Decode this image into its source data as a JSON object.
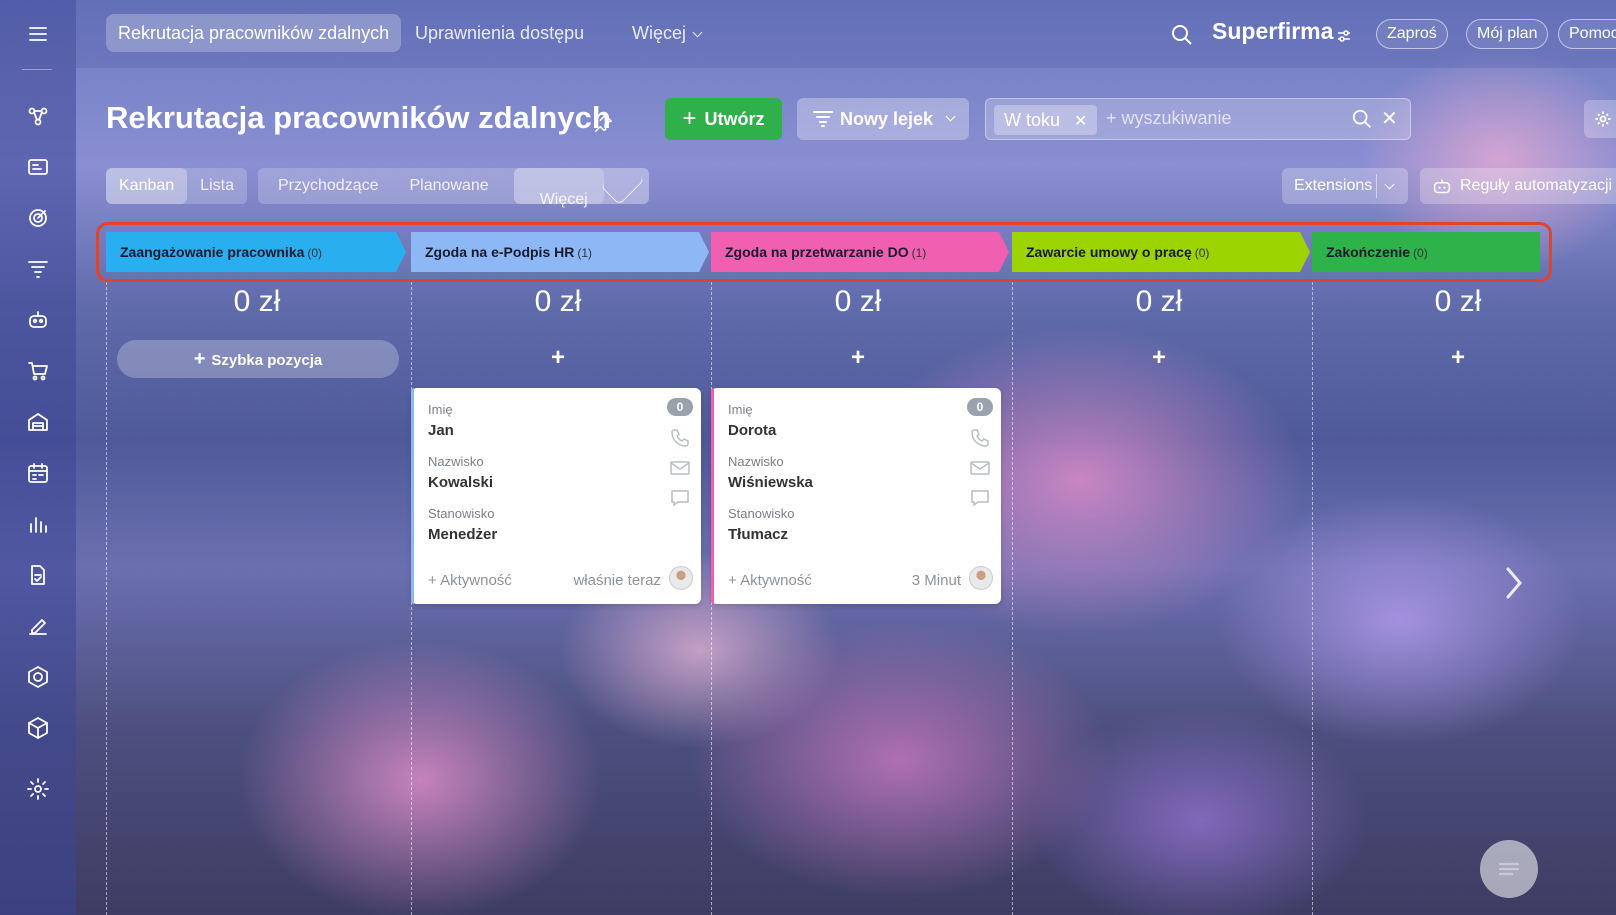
{
  "topbar": {
    "tabs": [
      {
        "label": "Rekrutacja pracowników zdalnych",
        "active": true
      },
      {
        "label": "Uprawnienia dostępu",
        "active": false
      },
      {
        "label": "Więcej",
        "active": false
      }
    ],
    "brand": "Superfirma",
    "invite": "Zaproś",
    "my_plan": "Mój plan",
    "help": "Pomoc"
  },
  "header": {
    "title": "Rekrutacja pracowników zdalnych",
    "create_label": "Utwórz",
    "funnel_label": "Nowy lejek",
    "filter_chip": "W toku",
    "search_placeholder": "+ wyszukiwanie"
  },
  "views": {
    "kanban": "Kanban",
    "list": "Lista",
    "incoming": "Przychodzące",
    "planned": "Planowane",
    "more": "Więcej",
    "extensions": "Extensions",
    "automation": "Reguły automatyzacji"
  },
  "stages": [
    {
      "name": "Zaangażowanie pracownika",
      "count": "(0)",
      "sum": "0 zł",
      "color": "#29aef0"
    },
    {
      "name": "Zgoda na e-Podpis HR",
      "count": "(1)",
      "sum": "0 zł",
      "color": "#8db8f5"
    },
    {
      "name": "Zgoda na przetwarzanie DO",
      "count": "(1)",
      "sum": "0 zł",
      "color": "#f05fb0"
    },
    {
      "name": "Zawarcie umowy o pracę",
      "count": "(0)",
      "sum": "0 zł",
      "color": "#9bd400"
    },
    {
      "name": "Zakończenie",
      "count": "(0)",
      "sum": "0 zł",
      "color": "#2db34a"
    }
  ],
  "quick_add": "Szybka pozycja",
  "cards": [
    {
      "first_name_label": "Imię",
      "first_name": "Jan",
      "last_name_label": "Nazwisko",
      "last_name": "Kowalski",
      "position_label": "Stanowisko",
      "position": "Menedżer",
      "badge": "0",
      "activity": "+ Aktywność",
      "time": "właśnie teraz"
    },
    {
      "first_name_label": "Imię",
      "first_name": "Dorota",
      "last_name_label": "Nazwisko",
      "last_name": "Wiśniewska",
      "position_label": "Stanowisko",
      "position": "Tłumacz",
      "badge": "0",
      "activity": "+ Aktywność",
      "time": "3 Minut"
    }
  ]
}
